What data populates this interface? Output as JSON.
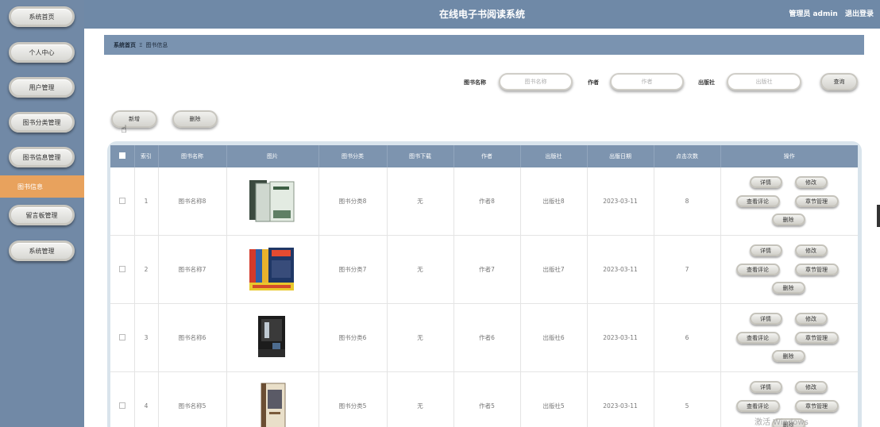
{
  "app": {
    "title": "在线电子书阅读系统",
    "admin_label": "管理员 admin",
    "logout": "退出登录"
  },
  "sidebar": {
    "items": [
      {
        "label": "系统首页"
      },
      {
        "label": "个人中心"
      },
      {
        "label": "用户管理"
      },
      {
        "label": "图书分类管理"
      },
      {
        "label": "图书信息管理"
      },
      {
        "label": "图书信息",
        "active": true
      },
      {
        "label": "留言板管理"
      },
      {
        "label": "系统管理"
      }
    ]
  },
  "breadcrumb": {
    "home": "系统首页",
    "separator": "Ξ",
    "current": "图书信息"
  },
  "search": {
    "name_label": "图书名称",
    "name_placeholder": "图书名称",
    "author_label": "作者",
    "author_placeholder": "作者",
    "publisher_label": "出版社",
    "publisher_placeholder": "出版社",
    "query_button": "查询"
  },
  "toolbar": {
    "add": "新增",
    "delete": "删除"
  },
  "table": {
    "headers": [
      "索引",
      "图书名称",
      "图片",
      "图书分类",
      "图书下载",
      "作者",
      "出版社",
      "出版日期",
      "点击次数",
      "操作"
    ],
    "rows": [
      {
        "index": "1",
        "name": "图书名称8",
        "category": "图书分类8",
        "download": "无",
        "author": "作者8",
        "publisher": "出版社8",
        "date": "2023-03-11",
        "clicks": "8"
      },
      {
        "index": "2",
        "name": "图书名称7",
        "category": "图书分类7",
        "download": "无",
        "author": "作者7",
        "publisher": "出版社7",
        "date": "2023-03-11",
        "clicks": "7"
      },
      {
        "index": "3",
        "name": "图书名称6",
        "category": "图书分类6",
        "download": "无",
        "author": "作者6",
        "publisher": "出版社6",
        "date": "2023-03-11",
        "clicks": "6"
      },
      {
        "index": "4",
        "name": "图书名称5",
        "category": "图书分类5",
        "download": "无",
        "author": "作者5",
        "publisher": "出版社5",
        "date": "2023-03-11",
        "clicks": "5"
      }
    ],
    "ops": {
      "detail": "详情",
      "edit": "修改",
      "comments": "查看评论",
      "chapters": "章节管理",
      "delete": "删除"
    }
  },
  "watermark": "激活 Windows",
  "colors": {
    "sidebar": "#7189a6",
    "header": "#6f89a7",
    "active_item": "#e8a25d",
    "table_header": "#7d94af"
  }
}
